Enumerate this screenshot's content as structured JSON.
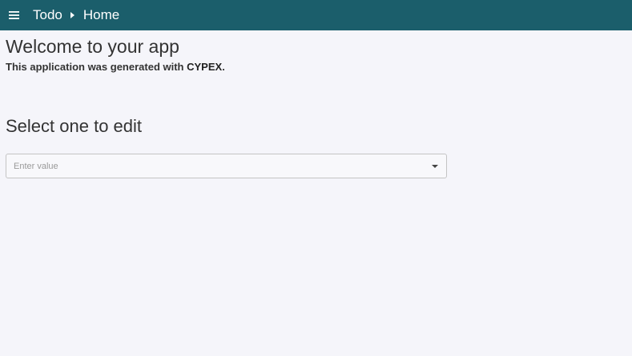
{
  "header": {
    "menu_icon": "hamburger-menu-icon",
    "breadcrumb": {
      "root": "Todo",
      "separator_icon": "caret-right-icon",
      "current": "Home"
    },
    "background_color": "#1b5e6b"
  },
  "main": {
    "welcome_title": "Welcome to your app",
    "subtitle_prefix": "This application was generated with ",
    "subtitle_brand": "CYPEX",
    "subtitle_suffix": ".",
    "select_title": "Select one to edit",
    "select": {
      "placeholder": "Enter value",
      "arrow_icon": "dropdown-arrow-icon"
    }
  }
}
